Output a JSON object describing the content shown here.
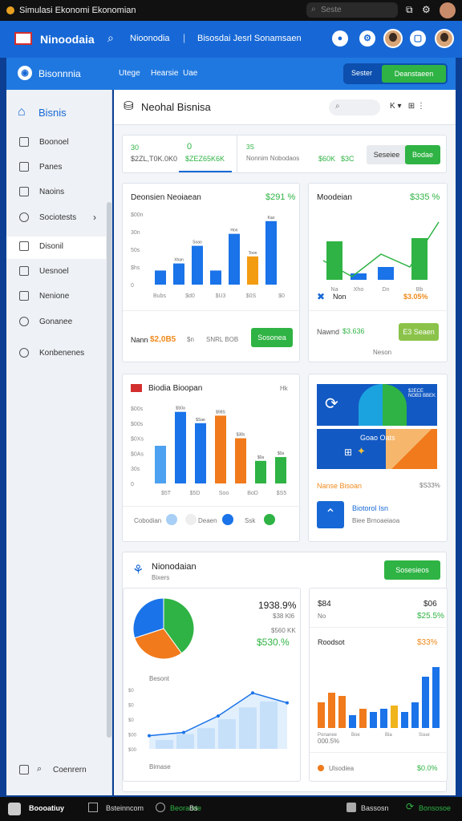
{
  "titlebar": {
    "title": "Simulasi Ekonomi Ekonomian",
    "search": "Seste"
  },
  "topbar": {
    "brand": "Ninoodaia",
    "link": "Nioonodia",
    "section": "Bisosdai Jesrl Sonamsaen"
  },
  "subbar": {
    "title": "Bisonnnia",
    "tabs": [
      "Utege",
      "Hearsie",
      "Uae"
    ],
    "btn_a": "Sester",
    "btn_b": "Deanstaeen"
  },
  "sidebar": {
    "items": [
      "Bisnis",
      "Boonoel",
      "Panes",
      "Naoins",
      "Sociotests",
      "Disonil",
      "Uesnoel",
      "Nenione",
      "Gonanee",
      "Konbenenes"
    ],
    "footer": "Coenrern"
  },
  "header": {
    "title": "Neohal Bisnisa",
    "icons": "K ▾   ⊞ ⋮"
  },
  "stats": {
    "a_top": "30",
    "a_val": "$2ZL,T0K.0K0",
    "b_top": "0",
    "b_val": "$ZEZ65K6K",
    "c_top": "3S",
    "c_label": "Nonnim Nobodaos",
    "c_v1": "$60K",
    "c_v2": "$3C",
    "btn1": "Seseiee",
    "btn2": "Bodae"
  },
  "card1": {
    "title": "Deonsien Neoiaean",
    "value": "$291 %",
    "footer_label": "Nann",
    "footer_value": "$2,0B5",
    "footer_mid": "$n",
    "footer_right": "SNRL BOB",
    "button": "Sosonea"
  },
  "card2": {
    "title": "Moodeian",
    "value": "$335 %",
    "legend1": "Non",
    "legend2": "$3.05%",
    "footer_label": "Nawnd",
    "footer_value": "$3.636",
    "button": "E3 Seaen",
    "footnote": "Neson"
  },
  "card3": {
    "title": "Biodia Bioopan",
    "corner": "Hk",
    "legend": [
      "Cobodian",
      "Deaen",
      "Ssk"
    ]
  },
  "card4": {
    "banner_text": "Goao Oats",
    "banner_small": "$2ECE NOB3 BBEK",
    "title": "Nanse Bisoan",
    "value": "$S33%",
    "sub_title": "Biotorol Isn",
    "sub_small": "Biee Brnoaeiaoa"
  },
  "panel": {
    "title": "Nionodaian",
    "subtitle": "Bixers",
    "button": "Sosesieos"
  },
  "pie": {
    "value": "1938.9%",
    "sub": "$38 Kl6",
    "label2": "$560 KK",
    "value2": "$530.%",
    "chart_label": "Besont",
    "bottom": "Bimase"
  },
  "right_panel": {
    "r1_left": "$84",
    "r1_right": "$06",
    "r2_left": "No",
    "r2_right": "$25.5%",
    "title": "Roodsot",
    "value": "$33%",
    "bottom_left": "000.5%",
    "footer_label": "Ulsodiea",
    "footer_value": "$0.0%"
  },
  "bottombar": {
    "items": [
      "Boooatiuy",
      "Bsteinncom",
      "Beoraode",
      "Bs",
      "Bassosn"
    ],
    "right": "Bonsosoe"
  },
  "chart_data": [
    {
      "type": "bar",
      "title": "Deonsien Neoiaean",
      "categories": [
        "Bubs",
        "$d0",
        "$U3",
        "$0S",
        "$0"
      ],
      "series": [
        {
          "name": "",
          "values": [
            20,
            30,
            55,
            20,
            72,
            40,
            90
          ]
        }
      ],
      "colors": [
        "#1a73e8",
        "#1a73e8",
        "#1a73e8",
        "#1a73e8",
        "#1a73e8",
        "#f39c12",
        "#1a73e8"
      ],
      "labels": [
        "",
        "Xhan",
        "Soao",
        "",
        "Hon",
        "Toon",
        "Kao"
      ],
      "yticks": [
        "$00n",
        "30n",
        "50s",
        "$hs",
        "0"
      ]
    },
    {
      "type": "bar",
      "title": "Moodeian",
      "categories": [
        "Na",
        "Xho",
        "Dn",
        "Bb"
      ],
      "values": [
        60,
        10,
        20,
        65
      ],
      "colors": [
        "#2fb344",
        "#1a73e8",
        "#1a73e8",
        "#2fb344"
      ],
      "line": [
        30,
        5,
        40,
        20,
        90
      ]
    },
    {
      "type": "bar",
      "title": "Biodia Bioopan",
      "categories": [
        "$5T",
        "$5D",
        "Soo",
        "BoD",
        "$S5"
      ],
      "values": [
        50,
        95,
        80,
        90,
        60,
        30,
        35
      ],
      "colors": [
        "#4ca1f0",
        "#1a73e8",
        "#1a73e8",
        "#f07a1c",
        "#f07a1c",
        "#2fb344",
        "#2fb344"
      ],
      "labels": [
        "",
        "$S0a",
        "$Sae",
        "$98S",
        "$38s",
        "$0a",
        "$0a"
      ],
      "yticks": [
        "$00s",
        "$00s",
        "$0Xs",
        "$0As",
        "30s",
        "0"
      ]
    },
    {
      "type": "pie",
      "values": [
        40,
        30,
        30
      ],
      "colors": [
        "#2fb344",
        "#f07a1c",
        "#1a73e8"
      ]
    },
    {
      "type": "area",
      "x": [
        1,
        2,
        3,
        4,
        5
      ],
      "values": [
        20,
        25,
        50,
        85,
        70
      ],
      "yticks": [
        "$0",
        "$0",
        "$0",
        "$00",
        "$00"
      ]
    },
    {
      "type": "bar",
      "values": [
        40,
        55,
        50,
        20,
        30,
        25,
        30,
        35,
        25,
        40,
        80,
        95
      ],
      "colors": [
        "#f07a1c",
        "#f07a1c",
        "#f07a1c",
        "#1a73e8",
        "#f07a1c",
        "#1a73e8",
        "#1a73e8",
        "#f0b41c",
        "#1a73e8",
        "#1a73e8",
        "#1a73e8",
        "#1a73e8"
      ],
      "labels": [
        "Ponanee",
        "Boe",
        "Bia",
        "Ssue"
      ]
    }
  ]
}
